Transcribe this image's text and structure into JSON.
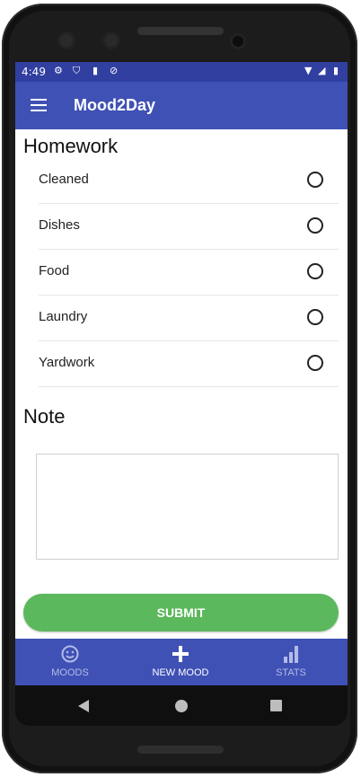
{
  "status_bar": {
    "time": "4:49",
    "left_icons": [
      "gear-icon",
      "shield-icon",
      "sd-card-icon",
      "no-disturb-icon"
    ],
    "right_icons": [
      "wifi-icon",
      "signal-icon",
      "battery-icon"
    ]
  },
  "app_bar": {
    "title": "Mood2Day",
    "menu_icon": "hamburger-menu-icon"
  },
  "homework": {
    "title": "Homework",
    "items": [
      {
        "label": "Cleaned",
        "selected": false
      },
      {
        "label": "Dishes",
        "selected": false
      },
      {
        "label": "Food",
        "selected": false
      },
      {
        "label": "Laundry",
        "selected": false
      },
      {
        "label": "Yardwork",
        "selected": false
      }
    ]
  },
  "note": {
    "title": "Note",
    "value": ""
  },
  "submit_label": "SUBMIT",
  "bottom_nav": {
    "items": [
      {
        "label": "MOODS",
        "icon": "smiley-icon",
        "active": false
      },
      {
        "label": "NEW MOOD",
        "icon": "plus-icon",
        "active": true
      },
      {
        "label": "STATS",
        "icon": "bar-chart-icon",
        "active": false
      }
    ]
  },
  "colors": {
    "primary": "#3f51b5",
    "status_bar": "#303fa0",
    "submit": "#5cb85c",
    "nav_inactive": "#b3bbe8",
    "nav_active": "#ffffff"
  }
}
